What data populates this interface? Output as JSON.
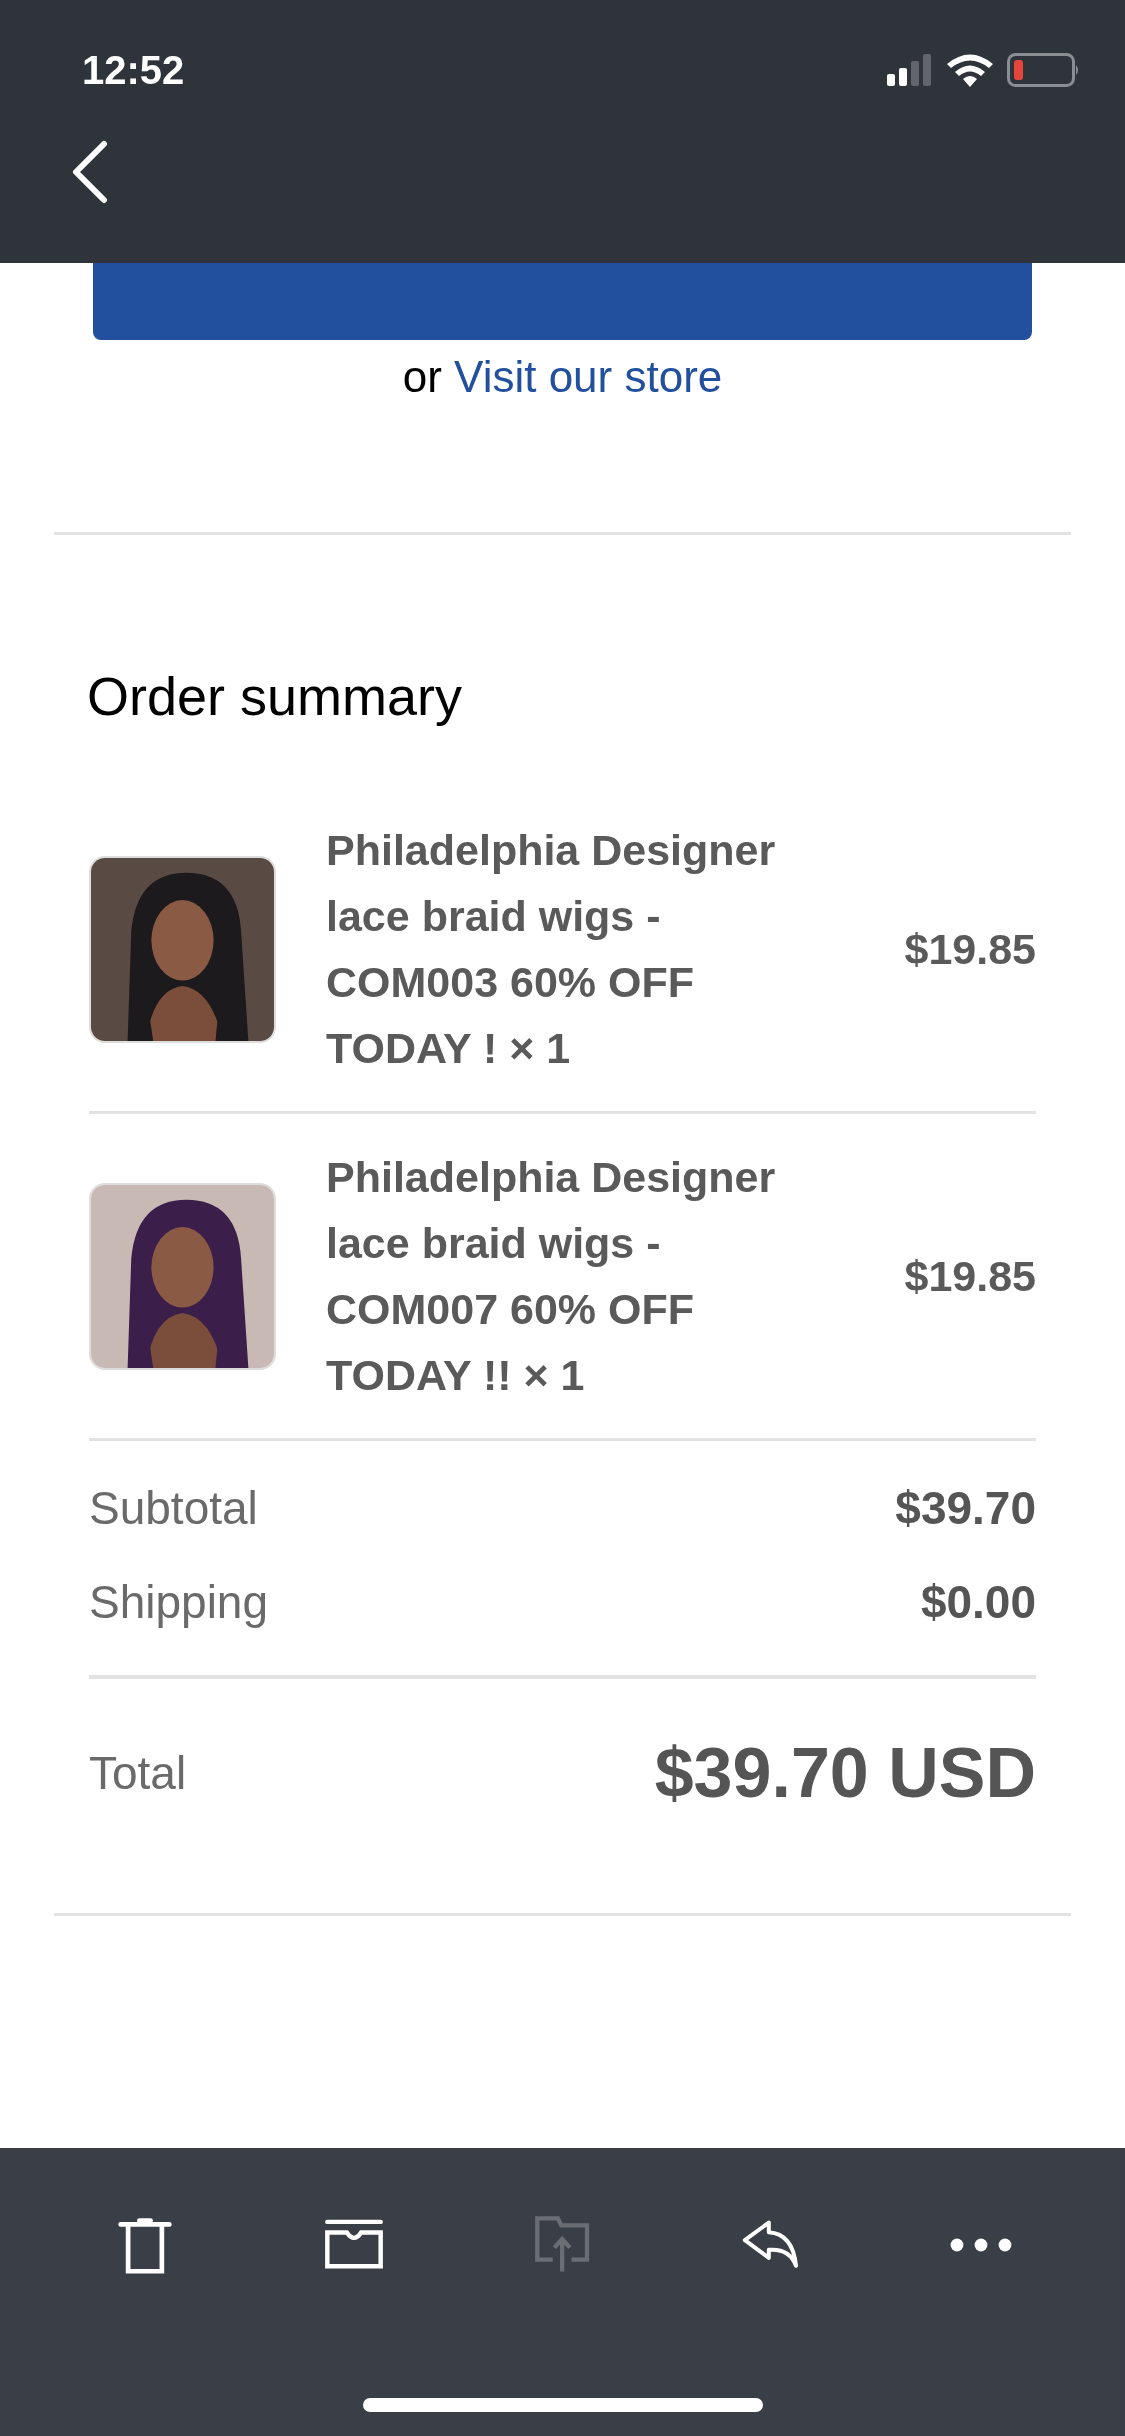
{
  "status_bar": {
    "time": "12:52"
  },
  "store_link": {
    "prefix": "or",
    "link": "Visit our store"
  },
  "order_summary": {
    "title": "Order summary",
    "items": [
      {
        "name": "Philadelphia Designer lace braid wigs - COM003 60% OFF TODAY ! × 1",
        "price": "$19.85"
      },
      {
        "name": "Philadelphia Designer lace braid wigs - COM007 60% OFF TODAY !! × 1",
        "price": "$19.85"
      }
    ],
    "costs": [
      {
        "label": "Subtotal",
        "value": "$39.70"
      },
      {
        "label": "Shipping",
        "value": "$0.00"
      }
    ],
    "total": {
      "label": "Total",
      "value": "$39.70 USD"
    }
  },
  "toolbar": [
    {
      "kind": "trash",
      "disabled": false
    },
    {
      "kind": "archive",
      "disabled": false
    },
    {
      "kind": "move",
      "disabled": true
    },
    {
      "kind": "reply",
      "disabled": false
    },
    {
      "kind": "more",
      "disabled": false
    }
  ]
}
